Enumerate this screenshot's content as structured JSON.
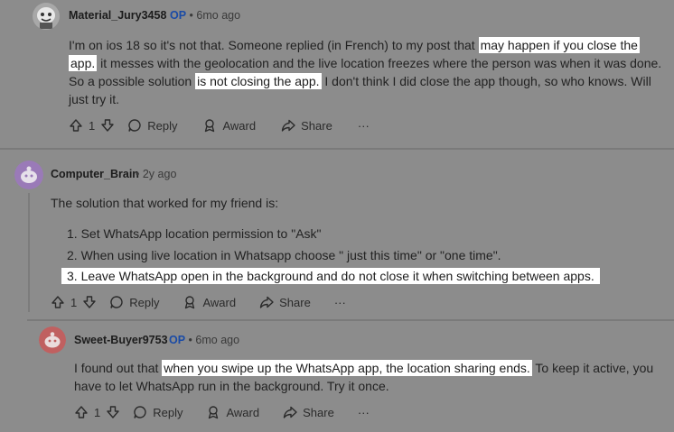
{
  "comments": [
    {
      "username": "Material_Jury3458",
      "op": "OP",
      "time": "6mo ago",
      "lines": [
        [
          "I'm on ios 18 so it's not that. Someone replied (in French) to my post that ",
          "may happen if you close the"
        ],
        [
          "app.",
          " it messes with the geolocation and the live location freezes where the person was when it was done."
        ],
        [
          "So a possible solution ",
          "is not closing the app.",
          " I don't think I did close the app though, so who knows. Will"
        ],
        [
          "just try it."
        ]
      ],
      "votes": "1",
      "reply": "Reply",
      "award": "Award",
      "share": "Share",
      "more": "···"
    },
    {
      "username": "Computer_Brain",
      "time": "2y ago",
      "intro": "The solution that worked for my friend is:",
      "items": [
        "1. Set WhatsApp location permission to \"Ask\"",
        "2. When using live location in Whatsapp choose \" just this time\" or \"one time\".",
        "3. Leave WhatsApp open in the background and do not close it when switching between apps."
      ],
      "votes": "1",
      "reply": "Reply",
      "award": "Award",
      "share": "Share",
      "more": "···"
    },
    {
      "username": "Sweet-Buyer9753",
      "op": "OP",
      "time": "6mo ago",
      "lines": [
        [
          "I found out that ",
          "when you swipe up the WhatsApp app, the location sharing ends.",
          " To keep it active, you"
        ],
        [
          "have to let WhatsApp run in the background. Try it once."
        ]
      ],
      "votes": "1",
      "reply": "Reply",
      "award": "Award",
      "share": "Share",
      "more": "···"
    }
  ],
  "colors": {
    "overlay": "#8c8c8c",
    "highlight": "#ffffff",
    "op_badge": "#1a4ba6",
    "avatar_2": "#9a7ab8",
    "avatar_3": "#c06060"
  }
}
